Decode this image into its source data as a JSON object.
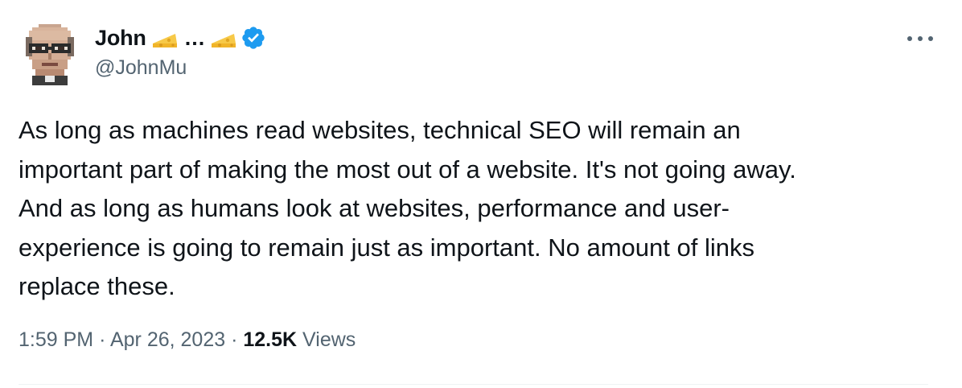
{
  "author": {
    "display_name": "John",
    "name_emoji_1": "cheese-emoji",
    "name_ellipsis": "...",
    "name_emoji_2": "cheese-emoji",
    "verified": true,
    "handle": "@JohnMu"
  },
  "tweet": {
    "lines": [
      "As long as machines read websites, technical SEO will remain an",
      "important part of making the most out of a website. It's not going away.",
      "And as long as humans look at websites, performance and user-",
      "experience is going to remain just as important. No amount of links",
      "replace these."
    ]
  },
  "meta": {
    "time": "1:59 PM",
    "separator": "·",
    "date": "Apr 26, 2023",
    "views_count": "12.5K",
    "views_label": "Views"
  },
  "colors": {
    "text_primary": "#0f1419",
    "text_secondary": "#536471",
    "verified_blue": "#1d9bf0",
    "divider": "#eff3f4"
  },
  "icons": {
    "more": "more-horizontal-icon",
    "verified": "verified-badge-icon"
  }
}
